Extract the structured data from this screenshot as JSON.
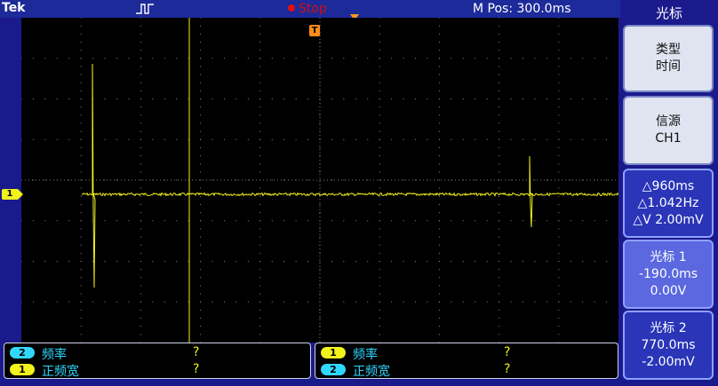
{
  "header": {
    "brand": "Tek",
    "trigger_icon": "rising-edge-pulse-icon",
    "run_state": "Stop",
    "mpos": "M Pos: 300.0ms"
  },
  "screen": {
    "trigger_marker": "T",
    "channel_marker": "1",
    "trace_color": "#f2f21c",
    "cursor1_ms": -190.0,
    "cursor2_ms": 770.0
  },
  "measurements": {
    "left": [
      {
        "channel": "2",
        "name": "频率",
        "value": "?"
      },
      {
        "channel": "1",
        "name": "正频宽",
        "value": "?"
      }
    ],
    "right": [
      {
        "channel": "1",
        "name": "频率",
        "value": "?"
      },
      {
        "channel": "2",
        "name": "正频宽",
        "value": "?"
      }
    ]
  },
  "menu": {
    "title": "光标",
    "type": {
      "line1": "类型",
      "line2": "时间"
    },
    "source": {
      "line1": "信源",
      "line2": "CH1"
    },
    "delta": {
      "line1": "△960ms",
      "line2": "△1.042Hz",
      "line3": "△V 2.00mV"
    },
    "cursor1": {
      "line1": "光标 1",
      "line2": "-190.0ms",
      "line3": "0.00V"
    },
    "cursor2": {
      "line1": "光标 2",
      "line2": "770.0ms",
      "line3": "-2.00mV"
    }
  },
  "colors": {
    "ch1": "#f2f21c",
    "ch2": "#30d8ff",
    "trigger": "#ff8c1a",
    "stop": "#e01010"
  }
}
